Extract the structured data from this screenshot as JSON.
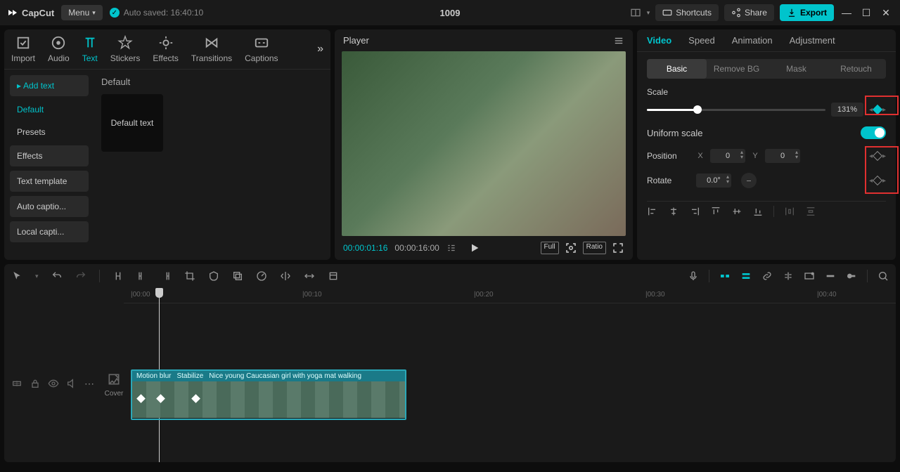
{
  "app": {
    "name": "CapCut",
    "menu": "Menu",
    "autosave": "Auto saved: 16:40:10",
    "title": "1009"
  },
  "topbar": {
    "shortcuts": "Shortcuts",
    "share": "Share",
    "export": "Export"
  },
  "tabs": [
    "Import",
    "Audio",
    "Text",
    "Stickers",
    "Effects",
    "Transitions",
    "Captions"
  ],
  "sidebar": {
    "addtext": "Add text",
    "default": "Default",
    "presets": "Presets",
    "effects": "Effects",
    "template": "Text template",
    "autocaption": "Auto captio...",
    "localcaption": "Local capti..."
  },
  "content": {
    "section": "Default",
    "card": "Default text"
  },
  "player": {
    "title": "Player",
    "cur": "00:00:01:16",
    "total": "00:00:16:00",
    "full": "Full",
    "ratio": "Ratio"
  },
  "right": {
    "tabs": [
      "Video",
      "Speed",
      "Animation",
      "Adjustment"
    ],
    "subtabs": [
      "Basic",
      "Remove BG",
      "Mask",
      "Retouch"
    ],
    "scale": "Scale",
    "scaleVal": "131%",
    "uniform": "Uniform scale",
    "position": "Position",
    "posX": "0",
    "posY": "0",
    "rotate": "Rotate",
    "rotVal": "0.0°"
  },
  "ruler": [
    "|00:00",
    "|00:10",
    "|00:20",
    "|00:30",
    "|00:40"
  ],
  "cover": "Cover",
  "clip": {
    "tags": [
      "Motion blur",
      "Stabilize"
    ],
    "name": "Nice young Caucasian girl with yoga mat walking"
  }
}
